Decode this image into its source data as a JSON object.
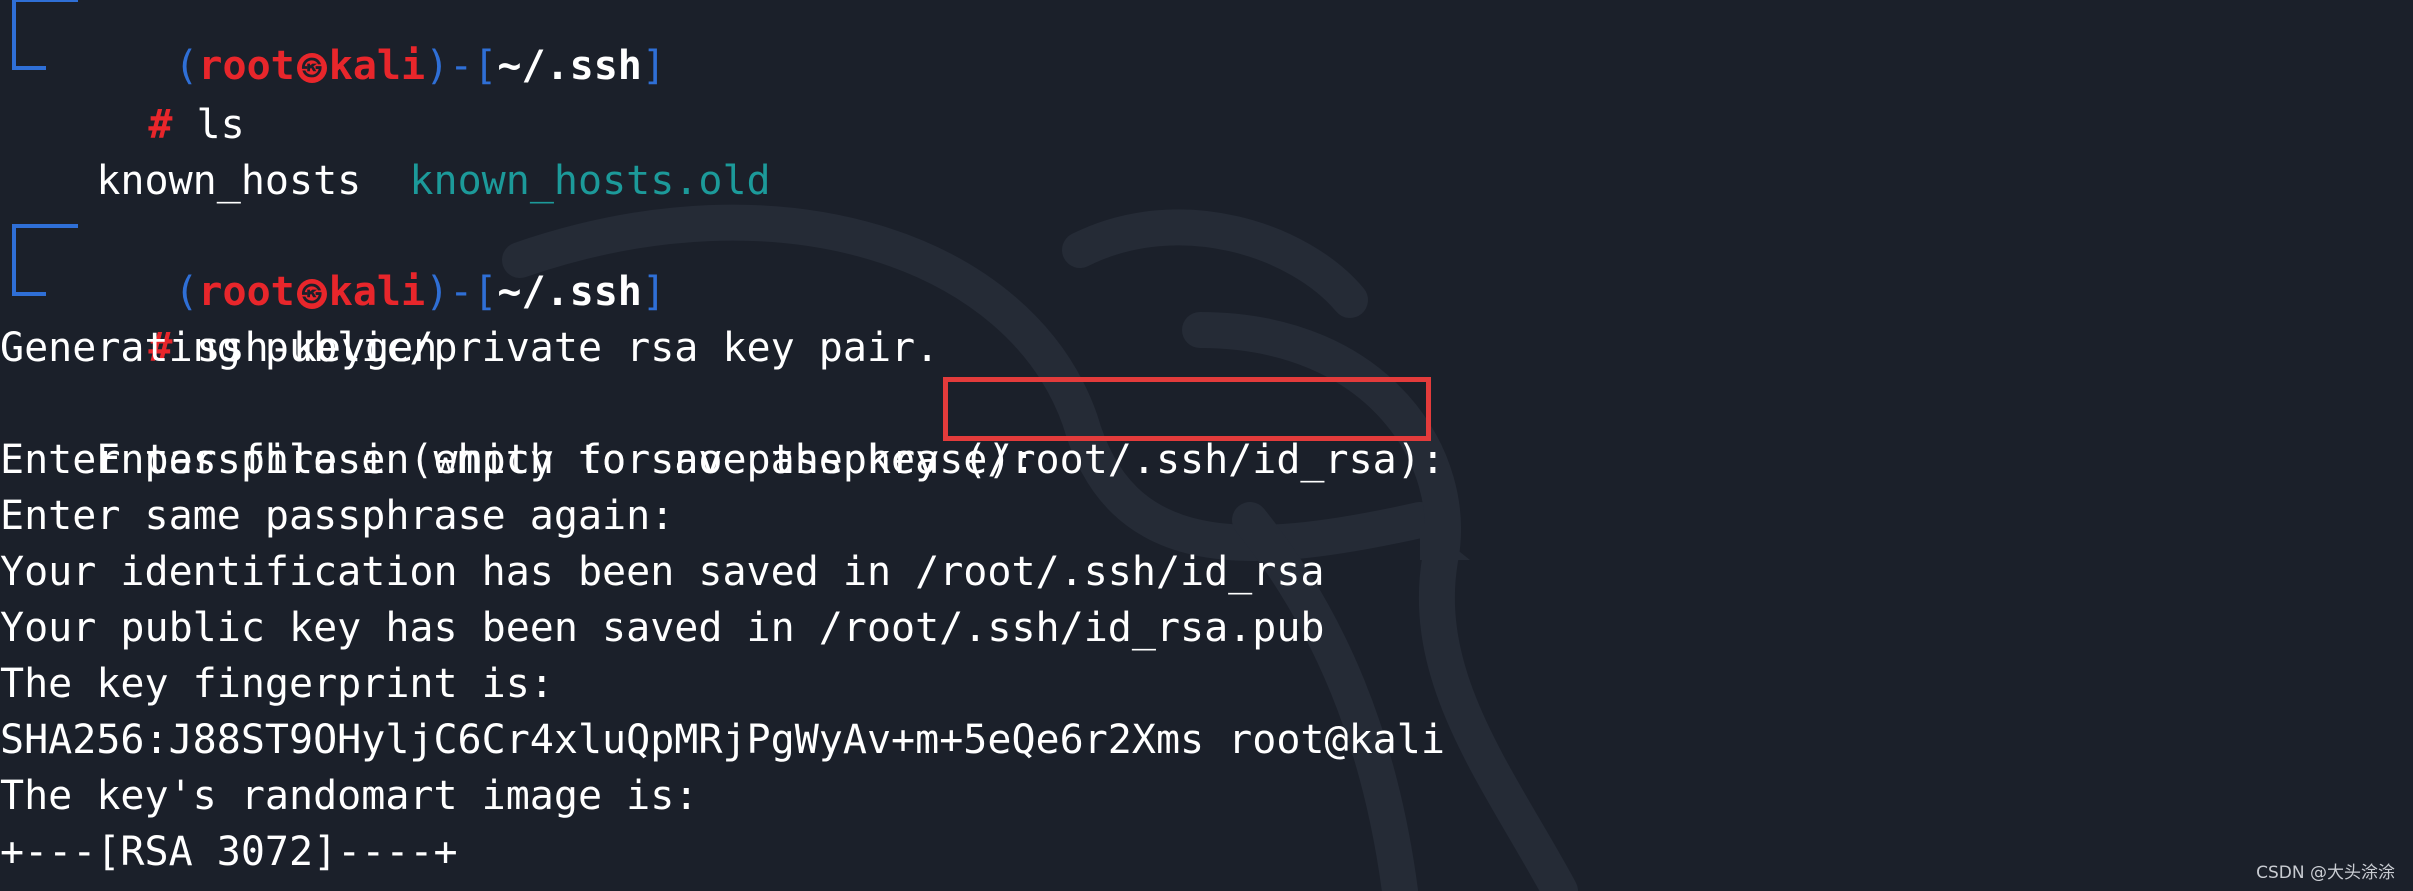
{
  "prompt": {
    "open_paren": "(",
    "user": "root",
    "skull_glyph": "㉿",
    "host": "kali",
    "close_paren": ")",
    "dash": "-",
    "open_bracket": "[",
    "cwd": "~/.ssh",
    "close_bracket": "]",
    "hash": "#"
  },
  "commands": {
    "ls": "ls",
    "keygen": "ssh-keygen"
  },
  "ls_output": {
    "file1": "known_hosts",
    "file2": "known_hosts.old"
  },
  "output": {
    "l1": "Generating public/private rsa key pair.",
    "l2_pre": "Enter file in which to save the key ",
    "l2_path": "(/root/.ssh/id_rsa)",
    "l2_post": ":",
    "l3": "Enter passphrase (empty for no passphrase):",
    "l4": "Enter same passphrase again:",
    "l5": "Your identification has been saved in /root/.ssh/id_rsa",
    "l6": "Your public key has been saved in /root/.ssh/id_rsa.pub",
    "l7": "The key fingerprint is:",
    "l8": "SHA256:J88ST9OHyljC6Cr4xluQpMRjPgWyAv+m+5eQe6r2Xms root@kali",
    "l9": "The key's randomart image is:",
    "l10": "+---[RSA 3072]----+"
  },
  "watermark": "CSDN @大头涂涂",
  "colors": {
    "background": "#1b202a",
    "prompt_blue": "#2f6fd6",
    "prompt_red": "#e8262b",
    "teal_file": "#1c9a9a",
    "highlight": "#e33b3b"
  }
}
